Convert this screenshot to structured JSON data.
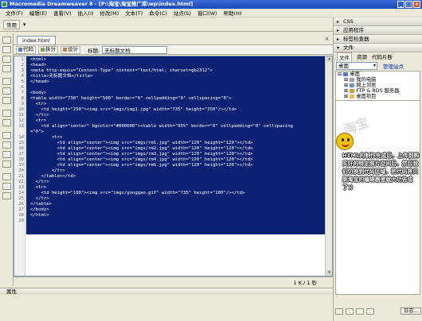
{
  "window": {
    "title": "Macromedia Dreamweaver 8 - [P:\\淘宝\\淘宝推广库\\wp\\index.html]"
  },
  "menu": [
    "文件(F)",
    "编辑(E)",
    "查看(V)",
    "插入(I)",
    "修改(M)",
    "文本(T)",
    "命令(C)",
    "站点(S)",
    "窗口(W)",
    "帮助(H)"
  ],
  "insertbar": {
    "category": "常用"
  },
  "document": {
    "tab": "index.html",
    "toolbar": {
      "code": "代码",
      "split": "拆分",
      "design": "设计",
      "title_label": "标题:",
      "title_value": "无标题文档"
    },
    "status": "1 K / 1 秒"
  },
  "code_lines": [
    {
      "n": "1",
      "text": "<html>"
    },
    {
      "n": "2",
      "text": "<head>"
    },
    {
      "n": "3",
      "text": "<meta http-equiv=\"Content-Type\" content=\"text/html; charset=gb2312\">"
    },
    {
      "n": "4",
      "text": "<title>无标题文档</title>"
    },
    {
      "n": "5",
      "text": "</head>"
    },
    {
      "n": "6",
      "text": ""
    },
    {
      "n": "7",
      "text": "<body>"
    },
    {
      "n": "8",
      "text": "<table width=\"730\" height=\"500\" border=\"0\" cellpadding=\"0\" cellspacing=\"0\">"
    },
    {
      "n": "9",
      "text": "  <tr>"
    },
    {
      "n": "10",
      "text": "    <td height=\"250\"><img src=\"imgs/img1.jpg\" width=\"735\" height=\"250\"/></td>"
    },
    {
      "n": "11",
      "text": "  </tr>"
    },
    {
      "n": "12",
      "text": "  <tr>"
    },
    {
      "n": "13",
      "text": "    <td align=\"center\" bgcolor=\"#000000\"><table width=\"95%\" border=\"0\" cellpadding=\"0\" cellspacing"
    },
    {
      "n": "",
      "text": "=\"0\">"
    },
    {
      "n": "14",
      "text": "        <tr>"
    },
    {
      "n": "15",
      "text": "          <td align=\"center\"><img src=\"imgs/rm1.jpg\" width=\"120\" height=\"120\"></td>"
    },
    {
      "n": "16",
      "text": "          <td align=\"center\"><img src=\"imgs/rm2.jpg\" width=\"120\" height=\"120\"></td>"
    },
    {
      "n": "17",
      "text": "          <td align=\"center\"><img src=\"imgs/rm3.jpg\" width=\"120\" height=\"120\"></td>"
    },
    {
      "n": "18",
      "text": "          <td align=\"center\"><img src=\"imgs/rm4.jpg\" width=\"120\" height=\"120\"></td>"
    },
    {
      "n": "19",
      "text": "          <td align=\"center\"><img src=\"imgs/rm5.jpg\" width=\"120\" height=\"120\"></td>"
    },
    {
      "n": "20",
      "text": "        </tr>"
    },
    {
      "n": "21",
      "text": "    </table></td>"
    },
    {
      "n": "22",
      "text": "  </tr>"
    },
    {
      "n": "23",
      "text": "  <tr>"
    },
    {
      "n": "24",
      "text": "    <td height=\"100\"><img src=\"imgs/gonggao.gif\" width=\"735\" height=\"100\"/></td>"
    },
    {
      "n": "25",
      "text": "  </tr>"
    },
    {
      "n": "26",
      "text": "</table>"
    },
    {
      "n": "27",
      "text": "</body>"
    },
    {
      "n": "28",
      "text": "</html>"
    },
    {
      "n": "29",
      "text": ""
    }
  ],
  "properties": {
    "label": "属性"
  },
  "right_panels": {
    "css": "CSS",
    "app": "应用程序",
    "tag_inspector": "标签检查器",
    "files_header": "文件",
    "files_tabs": [
      "文件",
      "资源",
      "代码片断"
    ],
    "site_select": "桌面",
    "manage_sites": "管理站点",
    "tree": [
      "桌面",
      "我的电脑",
      "网上邻居",
      "FTP & RDS 服务器",
      "桌面项目"
    ],
    "log_button": "日志..."
  },
  "callout": "HTML的制作完成后，上传到购买好的特定照片空间后，然后我们切换到代码区域，把代码将贝到淘宝的编辑器里就大功告成了：）",
  "colors": {
    "selection": "#0b2272",
    "titlebar": "#1947b8"
  }
}
